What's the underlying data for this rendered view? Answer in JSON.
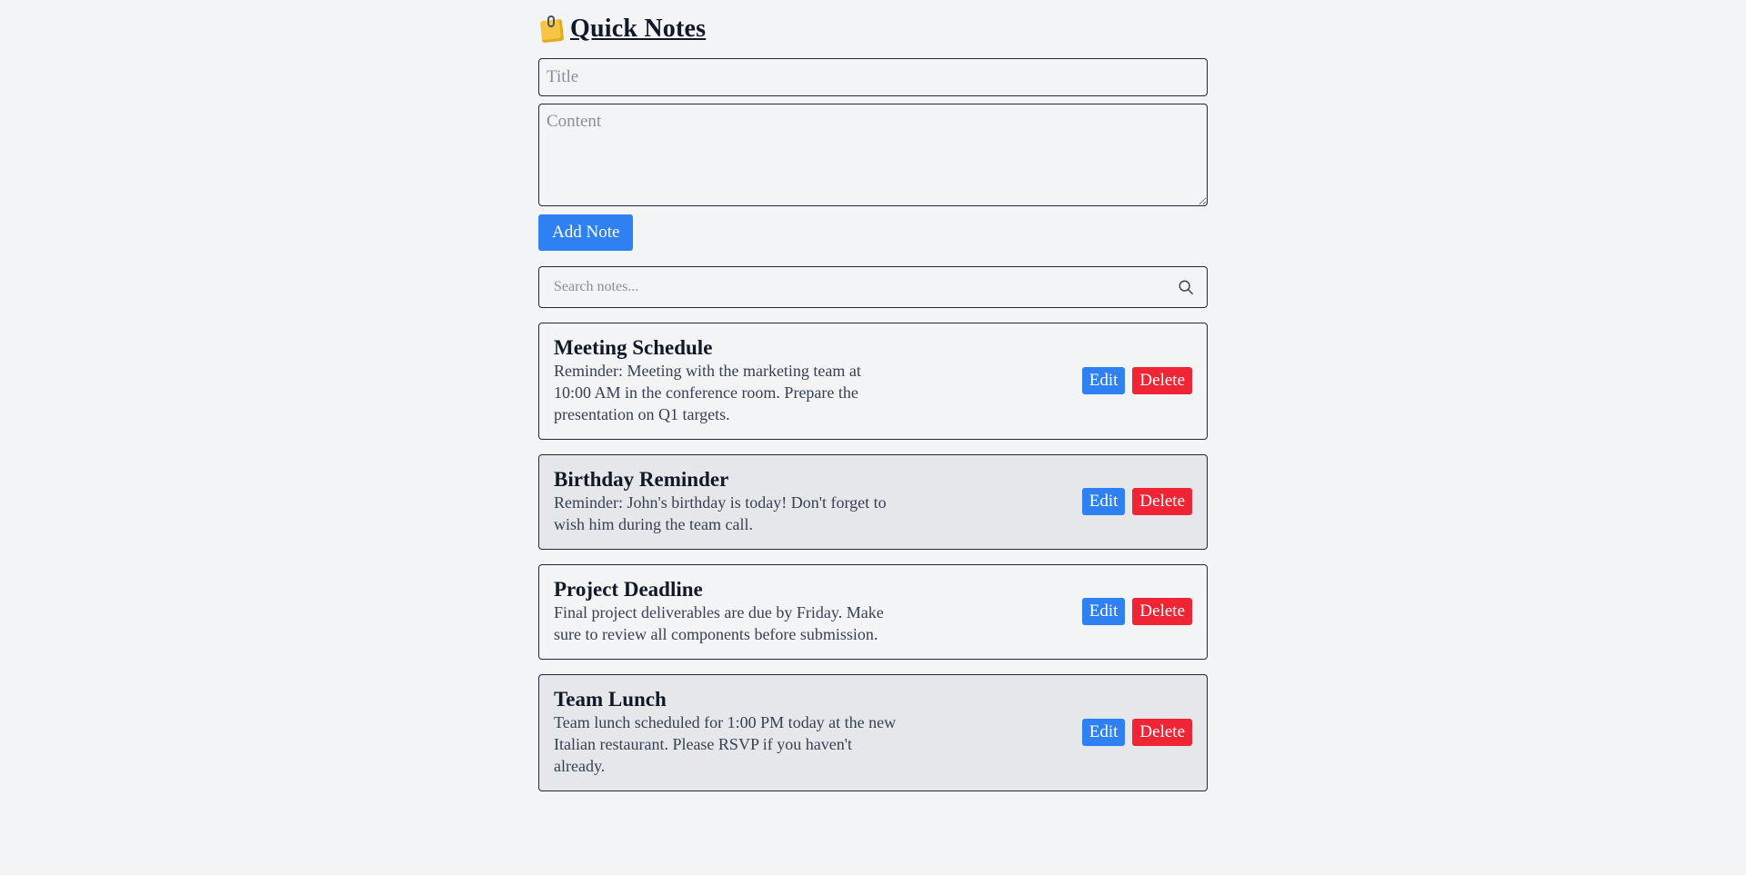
{
  "app": {
    "icon": "memo-icon",
    "title": "Quick Notes"
  },
  "form": {
    "title_placeholder": "Title",
    "title_value": "",
    "content_placeholder": "Content",
    "content_value": "",
    "add_label": "Add Note"
  },
  "search": {
    "placeholder": "Search notes...",
    "value": "",
    "icon": "search-icon"
  },
  "notes": [
    {
      "title": "Meeting Schedule",
      "lines": [
        "Reminder: Meeting with the marketing team at",
        "10:00 AM in the conference room. Prepare the",
        "presentation on Q1 targets."
      ],
      "edit_label": "Edit",
      "delete_label": "Delete"
    },
    {
      "title": "Birthday Reminder",
      "lines": [
        "Reminder: John's birthday is today! Don't forget to",
        "wish him during the team call."
      ],
      "edit_label": "Edit",
      "delete_label": "Delete"
    },
    {
      "title": "Project Deadline",
      "lines": [
        "Final project deliverables are due by Friday. Make",
        "sure to review all components before submission."
      ],
      "edit_label": "Edit",
      "delete_label": "Delete"
    },
    {
      "title": "Team Lunch",
      "lines": [
        "Team lunch scheduled for 1:00 PM today at the new",
        "Italian restaurant. Please RSVP if you haven't",
        "already."
      ],
      "edit_label": "Edit",
      "delete_label": "Delete"
    }
  ],
  "colors": {
    "background": "#f3f4f6",
    "card_alt": "#e5e7eb",
    "primary": "#2f80f2",
    "danger": "#ef2535",
    "border": "#1f2937"
  }
}
